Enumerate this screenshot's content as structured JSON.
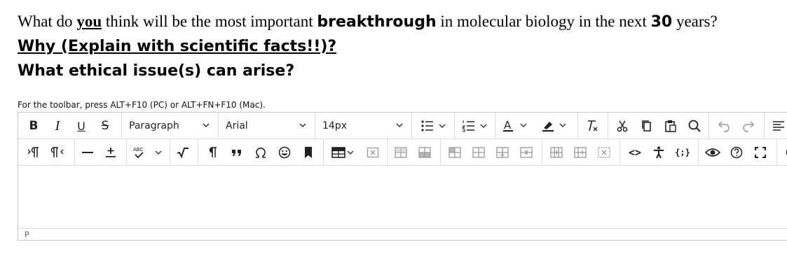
{
  "question": {
    "line1": {
      "p1": "What do ",
      "you": "you",
      "p2": " think will be the most important ",
      "breakthrough": "breakthrough",
      "p3": " in molecular biology in the next ",
      "num": "30",
      "p4": " years?"
    },
    "line2": "Why (Explain with scientific facts!!)?",
    "line3": "What ethical issue(s) can arise?"
  },
  "editor": {
    "toolbar_hint": "For the toolbar, press ALT+F10 (PC) or ALT+FN+F10 (Mac).",
    "block_format": "Paragraph",
    "font_family": "Arial",
    "font_size": "14px",
    "status_path": "P",
    "bold_label": "B",
    "italic_label": "I",
    "underline_label": "U",
    "strike_label": "S",
    "font_color_label": "A",
    "spellcheck_label": "ABC",
    "code_label": "<>",
    "template_label": "{;}"
  }
}
